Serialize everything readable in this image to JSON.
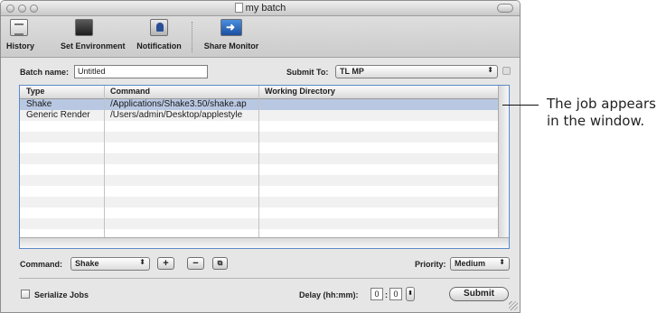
{
  "window": {
    "title": "my batch"
  },
  "toolbar": {
    "items": [
      {
        "label": "History",
        "icon": "history-icon"
      },
      {
        "label": "Set Environment",
        "icon": "environment-icon"
      },
      {
        "label": "Notification",
        "icon": "notification-icon"
      },
      {
        "label": "Share Monitor",
        "icon": "share-monitor-icon"
      }
    ]
  },
  "batch": {
    "name_label": "Batch name:",
    "name_value": "Untitled",
    "submit_to_label": "Submit To:",
    "submit_to_value": "TL MP"
  },
  "table": {
    "columns": [
      "Type",
      "Command",
      "Working Directory"
    ],
    "rows": [
      {
        "type": "Shake",
        "command": "/Applications/Shake3.50/shake.ap",
        "directory": "",
        "selected": true
      },
      {
        "type": "Generic Render",
        "command": "/Users/admin/Desktop/applestyle",
        "directory": "",
        "selected": false
      }
    ]
  },
  "command_bar": {
    "command_label": "Command:",
    "command_value": "Shake",
    "add_label": "+",
    "remove_label": "−",
    "duplicate_icon": "duplicate-icon",
    "priority_label": "Priority:",
    "priority_value": "Medium"
  },
  "footer": {
    "serialize_label": "Serialize Jobs",
    "serialize_checked": false,
    "delay_label": "Delay (hh:mm):",
    "delay_hours": "0",
    "delay_separator": ":",
    "delay_minutes": "0",
    "submit_label": "Submit"
  },
  "callout": {
    "line1": "The job appears",
    "line2": "in the window."
  },
  "colors": {
    "selection": "#b9c8e2",
    "table_focus_ring": "#5a8ac8",
    "window_bg": "#e6e6e6"
  }
}
